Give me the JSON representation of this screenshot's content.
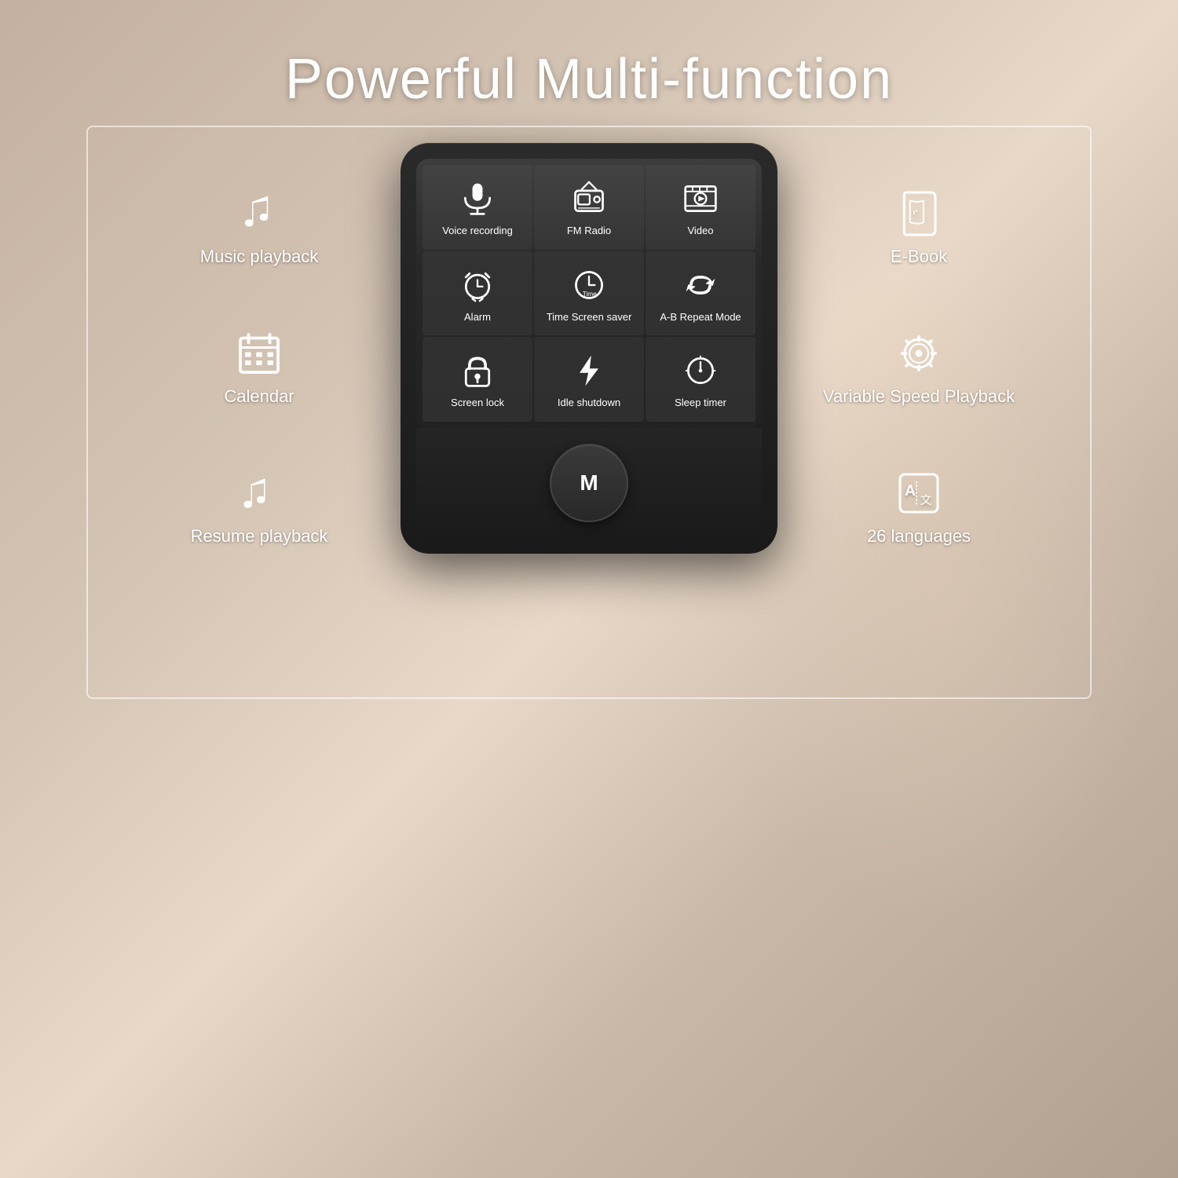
{
  "page": {
    "title": "Powerful Multi-function",
    "background_color": "#b8a898"
  },
  "features_left": [
    {
      "id": "music-playback",
      "label": "Music playback",
      "icon_type": "music"
    },
    {
      "id": "calendar",
      "label": "Calendar",
      "icon_type": "calendar"
    },
    {
      "id": "resume-playback",
      "label": "Resume playback",
      "icon_type": "resume"
    }
  ],
  "features_right": [
    {
      "id": "ebook",
      "label": "E-Book",
      "icon_type": "ebook"
    },
    {
      "id": "variable-speed",
      "label": "Variable Speed Playback",
      "icon_type": "speed"
    },
    {
      "id": "languages",
      "label": "26 languages",
      "icon_type": "languages"
    }
  ],
  "screen_items": [
    {
      "id": "voice-recording",
      "label": "Voice recording",
      "icon_type": "microphone"
    },
    {
      "id": "fm-radio",
      "label": "FM Radio",
      "icon_type": "radio"
    },
    {
      "id": "video",
      "label": "Video",
      "icon_type": "video"
    },
    {
      "id": "alarm",
      "label": "Alarm",
      "icon_type": "alarm"
    },
    {
      "id": "time-screen-saver",
      "label": "Time Screen saver",
      "icon_type": "time"
    },
    {
      "id": "ab-repeat",
      "label": "A-B Repeat Mode",
      "icon_type": "repeat"
    },
    {
      "id": "screen-lock",
      "label": "Screen lock",
      "icon_type": "lock"
    },
    {
      "id": "idle-shutdown",
      "label": "Idle shutdown",
      "icon_type": "lightning"
    },
    {
      "id": "sleep-timer",
      "label": "Sleep timer",
      "icon_type": "sleep"
    }
  ],
  "device": {
    "nav_button_label": "M"
  }
}
